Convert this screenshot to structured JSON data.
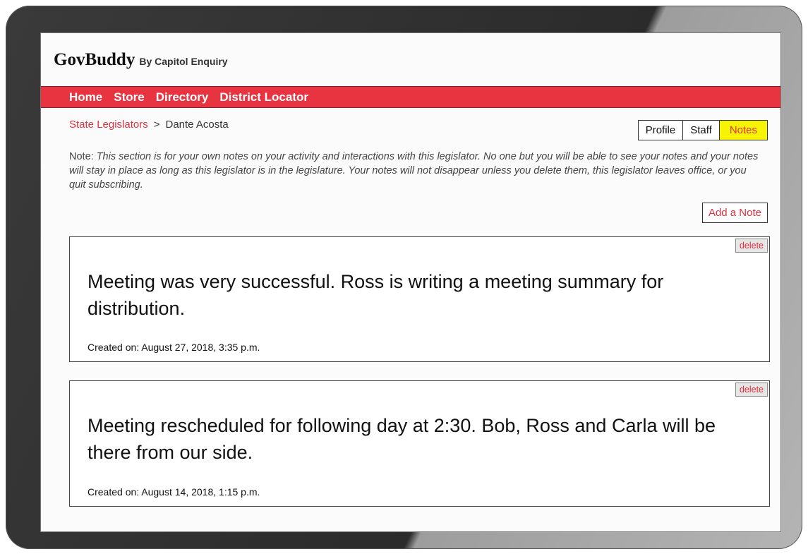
{
  "brand": {
    "name": "GovBuddy",
    "byline": "By Capitol Enquiry"
  },
  "nav": {
    "items": [
      "Home",
      "Store",
      "Directory",
      "District Locator"
    ]
  },
  "breadcrumb": {
    "parent": "State Legislators",
    "separator": ">",
    "current": "Dante Acosta"
  },
  "tabs": [
    {
      "label": "Profile",
      "active": false
    },
    {
      "label": "Staff",
      "active": false
    },
    {
      "label": "Notes",
      "active": true
    }
  ],
  "intro": {
    "label": "Note:",
    "text": "This section is for your own notes on your activity and interactions with this legislator. No one but you will be able to see your notes and your notes will stay in place as long  as this legislator is in the legislature. Your notes will not disappear unless you delete them, this legislator leaves office, or you quit subscribing."
  },
  "add_note_label": "Add a Note",
  "notes": [
    {
      "text": "Meeting was very successful. Ross is writing a meeting summary for distribution.",
      "created": "Created on: August 27, 2018, 3:35 p.m.",
      "delete_label": "delete"
    },
    {
      "text": "Meeting rescheduled for following day at 2:30. Bob, Ross and Carla will be there from our side.",
      "created": "Created on: August 14, 2018, 1:15 p.m.",
      "delete_label": "delete"
    }
  ],
  "colors": {
    "accent_red": "#e83340",
    "link_red": "#e0303d",
    "active_tab_yellow": "#f7f304"
  }
}
